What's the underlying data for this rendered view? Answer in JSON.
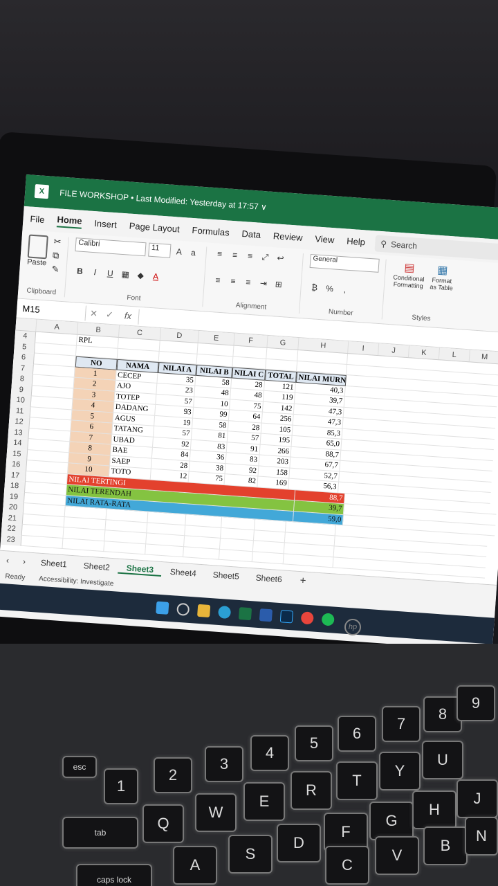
{
  "window": {
    "title": "FILE WORKSHOP • Last Modified: Yesterday at 17:57 ∨"
  },
  "menu": [
    "File",
    "Home",
    "Insert",
    "Page Layout",
    "Formulas",
    "Data",
    "Review",
    "View",
    "Help"
  ],
  "search_placeholder": "Search",
  "ribbon": {
    "paste": "Paste",
    "clipboard": "Clipboard",
    "font_name": "Calibri",
    "font_size": "11",
    "font_group": "Font",
    "alignment": "Alignment",
    "number_format": "General",
    "number_group": "Number",
    "conditional": "Conditional Formatting",
    "format_as_table": "Format as Table",
    "styles": "Styles"
  },
  "formula_bar": {
    "name_box": "M15",
    "fx": "fx"
  },
  "columns": [
    "A",
    "B",
    "C",
    "D",
    "E",
    "F",
    "G",
    "H",
    "I",
    "J",
    "K",
    "L",
    "M"
  ],
  "row_numbers": [
    "4",
    "5",
    "6",
    "7",
    "8",
    "9",
    "10",
    "11",
    "12",
    "13",
    "14",
    "15",
    "16",
    "17",
    "18",
    "19",
    "20",
    "21",
    "22",
    "23"
  ],
  "b4": "RPL",
  "table": {
    "headers": [
      "NO",
      "NAMA",
      "NILAI A",
      "NILAI B",
      "NILAI C",
      "TOTAL",
      "NILAI MURNI"
    ],
    "rows": [
      [
        "1",
        "CECEP",
        "35",
        "58",
        "28",
        "121",
        "40,3"
      ],
      [
        "2",
        "AJO",
        "23",
        "48",
        "48",
        "119",
        "39,7"
      ],
      [
        "3",
        "TOTEP",
        "57",
        "10",
        "75",
        "142",
        "47,3"
      ],
      [
        "4",
        "DADANG",
        "93",
        "99",
        "64",
        "256",
        "47,3"
      ],
      [
        "5",
        "AGUS",
        "19",
        "58",
        "28",
        "105",
        "85,3"
      ],
      [
        "6",
        "TATANG",
        "57",
        "81",
        "57",
        "195",
        "65,0"
      ],
      [
        "7",
        "UBAD",
        "92",
        "83",
        "91",
        "266",
        "88,7"
      ],
      [
        "8",
        "BAE",
        "84",
        "36",
        "83",
        "203",
        "67,7"
      ],
      [
        "9",
        "SAEP",
        "28",
        "38",
        "92",
        "158",
        "52,7"
      ],
      [
        "10",
        "TOTO",
        "12",
        "75",
        "82",
        "169",
        "56,3"
      ]
    ],
    "summary": [
      {
        "label": "NILAI TERTINGI",
        "value": "88,7",
        "color": "#e3412d"
      },
      {
        "label": "NILAI TERENDAH",
        "value": "39,7",
        "color": "#84c341"
      },
      {
        "label": "NILAI RATA-RATA",
        "value": "59,0",
        "color": "#42a8d8"
      }
    ]
  },
  "sheets": [
    "Sheet1",
    "Sheet2",
    "Sheet3",
    "Sheet4",
    "Sheet5",
    "Sheet6"
  ],
  "active_sheet": "Sheet3",
  "status": {
    "ready": "Ready",
    "accessibility": "Accessibility: Investigate"
  },
  "laptop_brand": "hp",
  "keys": [
    "esc",
    "tab",
    "caps lock",
    "1",
    "2",
    "3",
    "4",
    "5",
    "6",
    "7",
    "8",
    "9",
    "Q",
    "W",
    "E",
    "R",
    "T",
    "Y",
    "U",
    "A",
    "S",
    "D",
    "F",
    "G",
    "H",
    "J",
    "C",
    "V",
    "B",
    "N"
  ]
}
